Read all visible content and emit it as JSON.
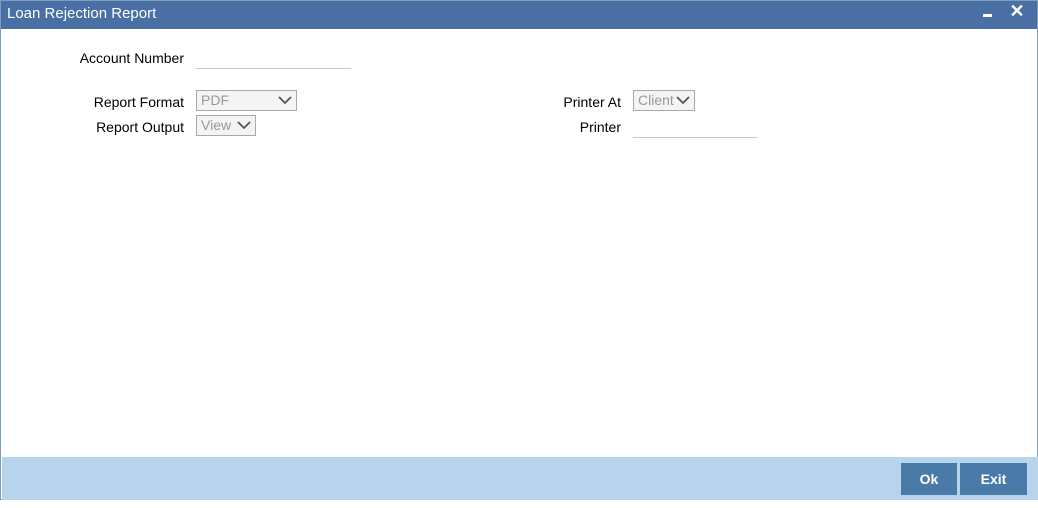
{
  "window": {
    "title": "Loan Rejection Report",
    "minimize_icon": "minimize-icon",
    "close_symbol": "✕"
  },
  "form": {
    "account_number": {
      "label": "Account Number",
      "value": ""
    },
    "report_format": {
      "label": "Report Format",
      "selected": "PDF"
    },
    "report_output": {
      "label": "Report Output",
      "selected": "View"
    },
    "printer_at": {
      "label": "Printer At",
      "selected": "Client"
    },
    "printer": {
      "label": "Printer",
      "value": ""
    }
  },
  "footer": {
    "ok_label": "Ok",
    "exit_label": "Exit"
  },
  "colors": {
    "titlebar": "#4a6fa5",
    "footer": "#b8d4ec",
    "button": "#4a7aa8"
  }
}
